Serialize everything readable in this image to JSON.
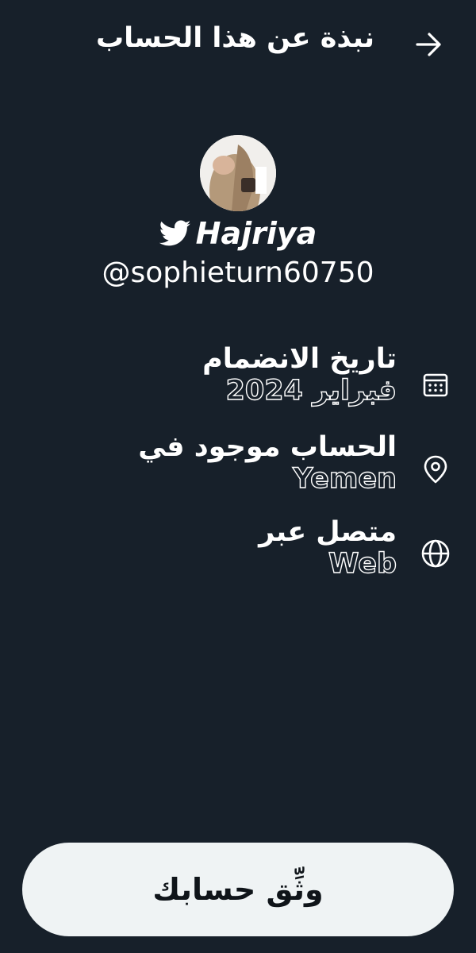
{
  "header": {
    "title": "نبذة عن هذا الحساب",
    "back_icon": "arrow-right-icon"
  },
  "profile": {
    "name": "Hajriya",
    "handle": "@sophieturn60750",
    "badge_icon": "twitter-bird-icon",
    "avatar_icon": "profile-photo"
  },
  "info": [
    {
      "label": "تاريخ الانضمام",
      "value": "فبراير 2024",
      "icon": "calendar-icon"
    },
    {
      "label": "الحساب موجود في",
      "value": "Yemen",
      "icon": "location-pin-icon"
    },
    {
      "label": "متصل عبر",
      "value": "Web",
      "icon": "globe-icon"
    }
  ],
  "verify_button": {
    "label": "وثِّق حسابك"
  },
  "colors": {
    "background": "#17202a",
    "text": "#ffffff",
    "button_bg": "#eff3f4",
    "button_text": "#0f1419"
  }
}
